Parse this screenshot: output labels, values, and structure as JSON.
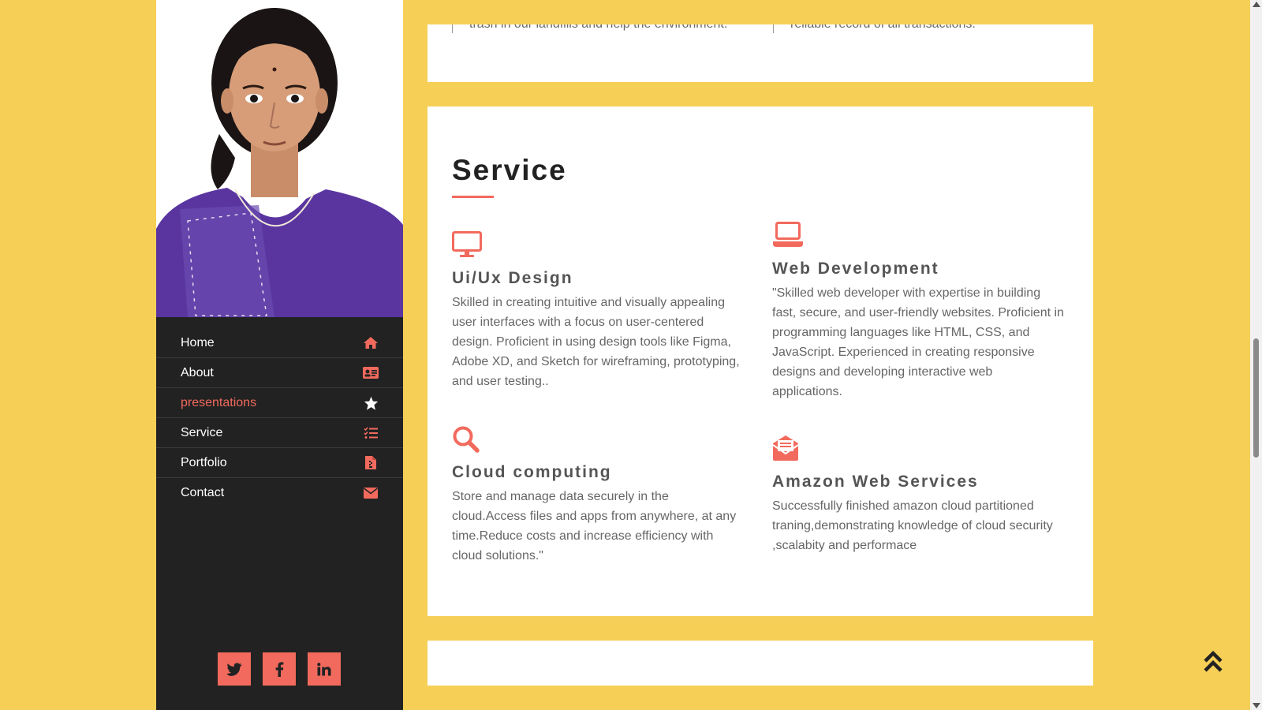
{
  "nav": {
    "items": [
      {
        "label": "Home",
        "icon": "home-icon"
      },
      {
        "label": "About",
        "icon": "id-card-icon"
      },
      {
        "label": "presentations",
        "icon": "star-icon",
        "active": true
      },
      {
        "label": "Service",
        "icon": "list-icon"
      },
      {
        "label": "Portfolio",
        "icon": "file-icon"
      },
      {
        "label": "Contact",
        "icon": "envelope-icon"
      }
    ],
    "active_color": "#f26a5d"
  },
  "social": [
    {
      "name": "twitter",
      "glyph": "t"
    },
    {
      "name": "facebook",
      "glyph": "f"
    },
    {
      "name": "linkedin",
      "glyph": "in"
    }
  ],
  "top_card": {
    "left_text": "trash in our landfills and help the environment.",
    "right_text": "reliable record of all transactions."
  },
  "service": {
    "title": "Service",
    "items": [
      {
        "icon": "monitor-icon",
        "title": "Ui/Ux Design",
        "desc": "Skilled in creating intuitive and visually appealing user interfaces with a focus on user-centered design. Proficient in using design tools like Figma, Adobe XD, and Sketch for wireframing, prototyping, and user testing.."
      },
      {
        "icon": "laptop-icon",
        "title": "Web Development",
        "desc": "\"Skilled web developer with expertise in building fast, secure, and user-friendly websites. Proficient in programming languages like HTML, CSS, and JavaScript. Experienced in creating responsive designs and developing interactive web applications."
      },
      {
        "icon": "search-icon",
        "title": "Cloud computing",
        "desc": "Store and manage data securely in the cloud.Access files and apps from anywhere, at any time.Reduce costs and increase efficiency with cloud solutions.\""
      },
      {
        "icon": "envelope-open-icon",
        "title": "Amazon Web Services",
        "desc": "Successfully finished amazon cloud partitioned traning,demonstrating knowledge of cloud security ,scalabity and performace"
      }
    ]
  },
  "colors": {
    "accent": "#f26a5d",
    "background": "#f6cf56",
    "sidebar": "#222222"
  }
}
